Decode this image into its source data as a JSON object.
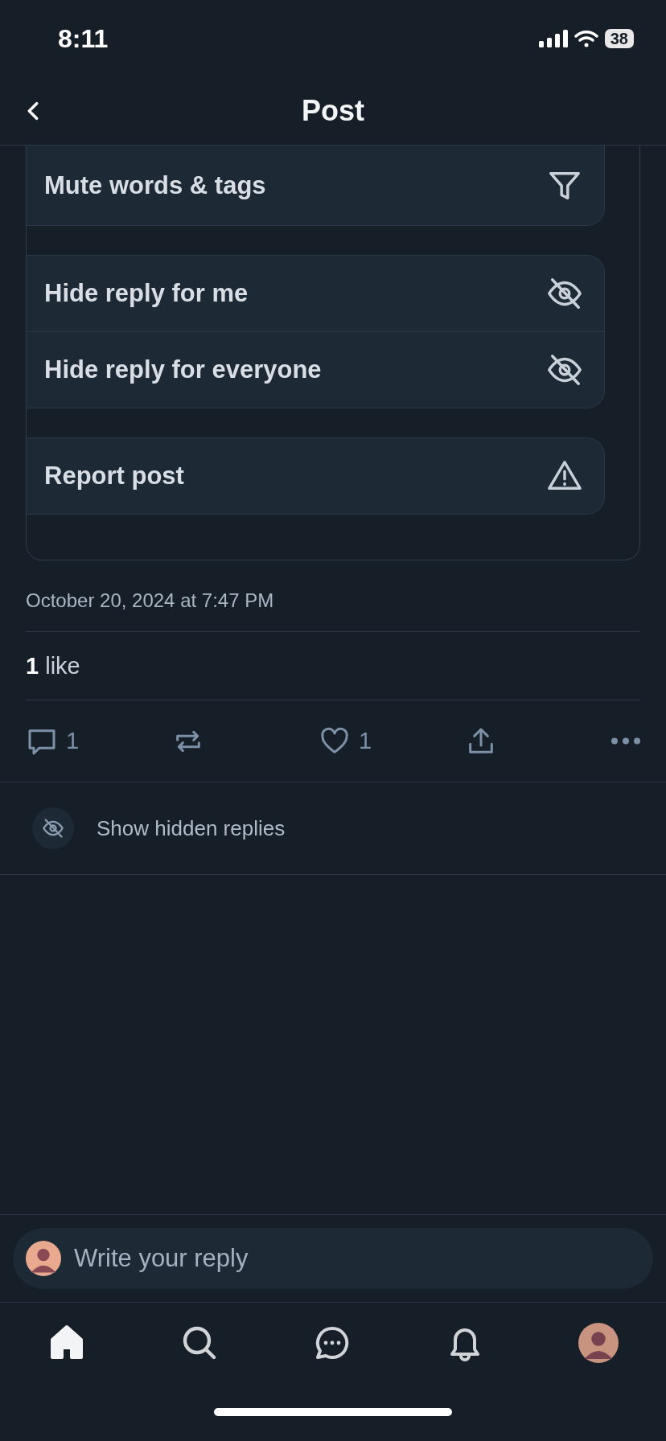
{
  "status_bar": {
    "time": "8:11",
    "battery": "38"
  },
  "header": {
    "title": "Post"
  },
  "menu_groups": [
    [
      {
        "label": "Mute words & tags",
        "kind": "filter"
      }
    ],
    [
      {
        "label": "Hide reply for me",
        "kind": "hide"
      },
      {
        "label": "Hide reply for everyone",
        "kind": "hide"
      }
    ],
    [
      {
        "label": "Report post",
        "kind": "report"
      }
    ]
  ],
  "timestamp": "October 20, 2024 at 7:47 PM",
  "likes": "**1** like",
  "actions": [
    {
      "kind": "reply",
      "count": "1"
    },
    {
      "kind": "repost"
    },
    {
      "kind": "like",
      "count": "1"
    },
    {
      "kind": "share"
    },
    {
      "kind": "more"
    }
  ],
  "hidden_replies": {
    "label": "Show hidden replies"
  },
  "reply": {
    "placeholder": "Write your reply"
  },
  "tab_bar": [
    {
      "kind": "home",
      "selected": true
    },
    {
      "kind": "search",
      "selected": false
    },
    {
      "kind": "chat",
      "selected": false
    },
    {
      "kind": "notifications",
      "selected": false
    },
    {
      "kind": "profile",
      "selected": false
    }
  ]
}
